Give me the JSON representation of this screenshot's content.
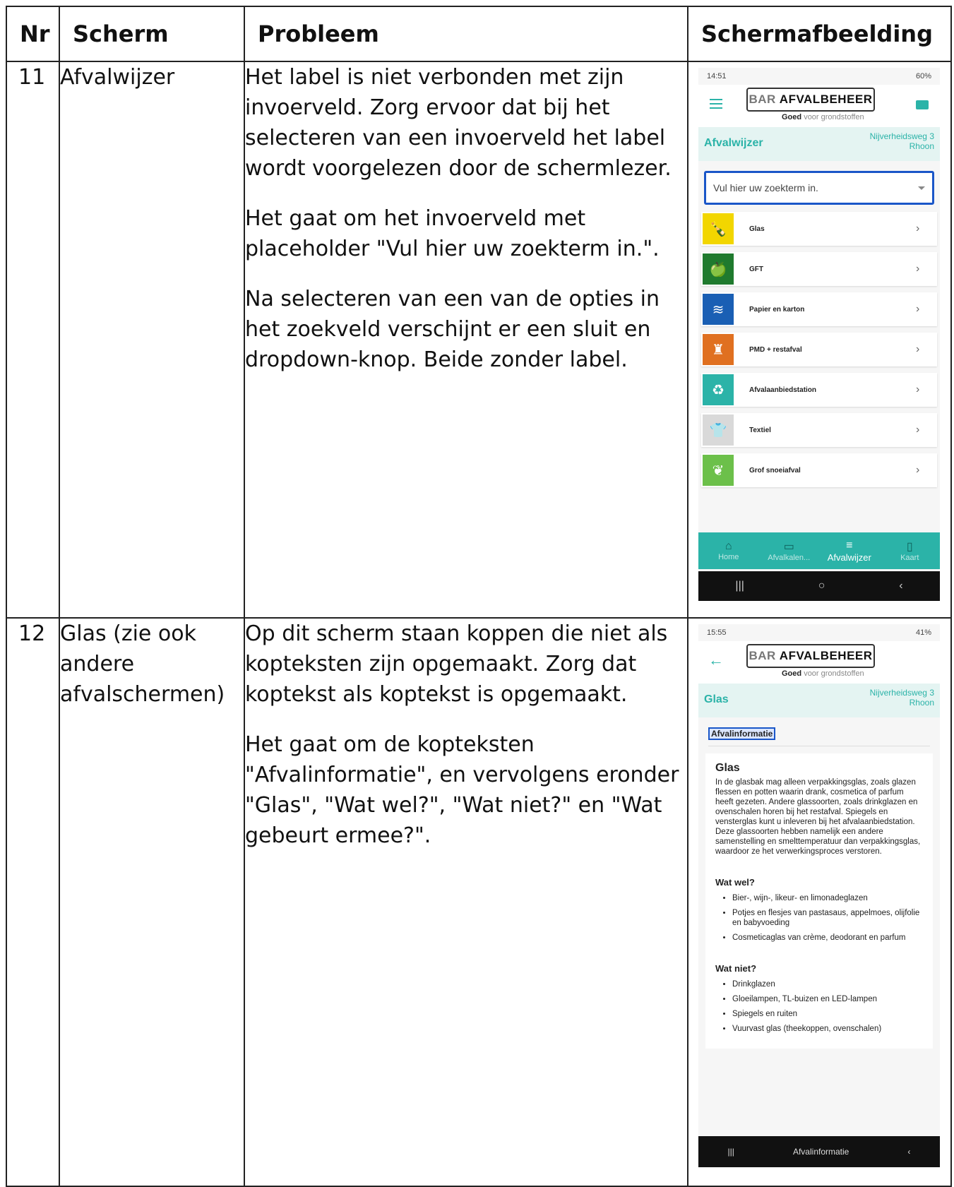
{
  "headers": {
    "nr": "Nr",
    "scherm": "Scherm",
    "probleem": "Probleem",
    "schermafbeelding": "Schermafbeelding"
  },
  "rows": [
    {
      "nr": "11",
      "scherm": "Afvalwijzer",
      "probleem": [
        "Het label is niet verbonden met zijn invoerveld. Zorg ervoor dat bij het selecteren van een invoerveld het label wordt voorgelezen door de schermlezer.",
        "Het gaat om het invoerveld met placeholder \"Vul hier uw zoekterm in.\".",
        "Na selecteren van een van de opties in het zoekveld verschijnt er een sluit en dropdown-knop. Beide zonder label."
      ],
      "screenshot": {
        "status_time": "14:51",
        "status_right": "60%",
        "logo_bar": "BAR",
        "logo_name": "AFVALBEHEER",
        "tagline_bold": "Goed",
        "tagline_rest": "voor grondstoffen",
        "title": "Afvalwijzer",
        "address_line1": "Nijverheidsweg 3",
        "address_line2": "Rhoon",
        "search_placeholder": "Vul hier uw zoekterm in.",
        "categories": [
          {
            "label": "Glas",
            "color": "#f2d600",
            "icon": "bottle-icon"
          },
          {
            "label": "GFT",
            "color": "#1f7a2e",
            "icon": "apple-core-icon"
          },
          {
            "label": "Papier en karton",
            "color": "#1a5fb4",
            "icon": "paper-stack-icon"
          },
          {
            "label": "PMD + restafval",
            "color": "#e07020",
            "icon": "trash-bag-icon"
          },
          {
            "label": "Afvalaanbiedstation",
            "color": "#2bb3a8",
            "icon": "recycle-icon"
          },
          {
            "label": "Textiel",
            "color": "#d9d9d9",
            "icon": "shirt-icon"
          },
          {
            "label": "Grof snoeiafval",
            "color": "#6cc04a",
            "icon": "branch-icon"
          }
        ],
        "nav": [
          {
            "label": "Home",
            "icon": "home-icon"
          },
          {
            "label": "Afvalkalen...",
            "icon": "calendar-icon"
          },
          {
            "label": "Afvalwijzer",
            "icon": "search-list-icon"
          },
          {
            "label": "Kaart",
            "icon": "map-icon"
          }
        ]
      }
    },
    {
      "nr": "12",
      "scherm": "Glas (zie ook andere afvalschermen)",
      "probleem": [
        "Op dit scherm staan koppen die niet als kopteksten zijn opgemaakt. Zorg dat koptekst als koptekst is opgemaakt.",
        "Het gaat om de kopteksten \"Afvalinformatie\", en vervolgens eronder \"Glas\", \"Wat wel?\", \"Wat niet?\" en \"Wat gebeurt ermee?\"."
      ],
      "screenshot": {
        "status_time": "15:55",
        "status_right": "41%",
        "logo_bar": "BAR",
        "logo_name": "AFVALBEHEER",
        "tagline_bold": "Goed",
        "tagline_rest": "voor grondstoffen",
        "title": "Glas",
        "address_line1": "Nijverheidsweg 3",
        "address_line2": "Rhoon",
        "highlight": "Afvalinformatie",
        "card_title": "Glas",
        "card_text": "In de glasbak mag alleen verpakkingsglas, zoals glazen flessen en potten waarin drank, cosmetica of parfum heeft gezeten. Andere glassoorten, zoals drinkglazen en ovenschalen horen bij het restafval. Spiegels en vensterglas kunt u inleveren bij het afvalaanbiedstation. Deze glassoorten hebben namelijk een andere samenstelling en smelttemperatuur dan verpakkingsglas, waardoor ze het verwerkingsproces verstoren.",
        "wat_wel_title": "Wat wel?",
        "wat_wel": [
          "Bier-, wijn-, likeur- en limonadeglazen",
          "Potjes en flesjes van pastasaus, appelmoes, olijfolie en babyvoeding",
          "Cosmeticaglas van crème, deodorant en parfum"
        ],
        "wat_niet_title": "Wat niet?",
        "wat_niet": [
          "Drinkglazen",
          "Gloeilampen, TL-buizen en LED-lampen",
          "Spiegels en ruiten",
          "Vuurvast glas (theekoppen, ovenschalen)"
        ],
        "tooltip": "Afvalinformatie"
      }
    }
  ]
}
